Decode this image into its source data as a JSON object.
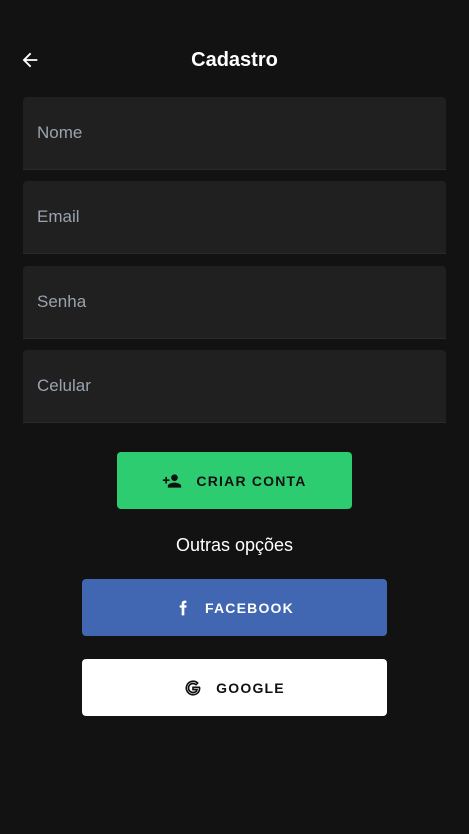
{
  "header": {
    "title": "Cadastro",
    "back_icon": "arrow-left-icon"
  },
  "form": {
    "fields": [
      {
        "name": "nome",
        "placeholder": "Nome",
        "value": ""
      },
      {
        "name": "email",
        "placeholder": "Email",
        "value": ""
      },
      {
        "name": "senha",
        "placeholder": "Senha",
        "value": ""
      },
      {
        "name": "celular",
        "placeholder": "Celular",
        "value": ""
      }
    ]
  },
  "actions": {
    "create_account": {
      "label": "CRIAR CONTA",
      "icon": "person-add-icon",
      "color": "#2ecc71"
    },
    "other_options_label": "Outras opções",
    "facebook": {
      "label": "FACEBOOK",
      "icon": "facebook-icon",
      "color": "#4267b2"
    },
    "google": {
      "label": "GOOGLE",
      "icon": "google-icon",
      "color": "#ffffff"
    }
  },
  "colors": {
    "background": "#121212",
    "field_background": "#202020",
    "placeholder": "#9aa3ad"
  }
}
